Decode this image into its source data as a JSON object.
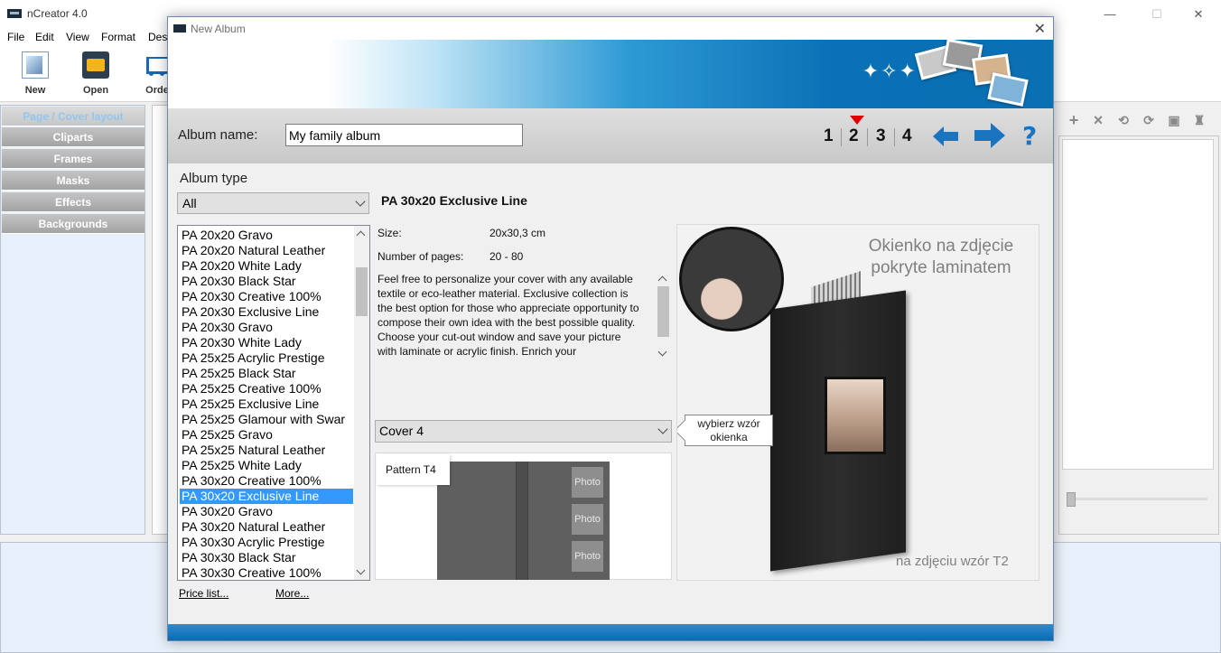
{
  "app": {
    "title": "nCreator 4.0",
    "menu": [
      "File",
      "Edit",
      "View",
      "Format",
      "Desi"
    ],
    "toolbar": [
      "New",
      "Open",
      "Orde"
    ],
    "left_panel": [
      "Page / Cover layout",
      "Cliparts",
      "Frames",
      "Masks",
      "Effects",
      "Backgrounds"
    ],
    "window_controls": {
      "minimize": "—",
      "maximize": "☐",
      "close": "✕"
    }
  },
  "dialog": {
    "title": "New Album",
    "close": "✕",
    "album_name_label": "Album name:",
    "album_name_value": "My family album",
    "steps": [
      "1",
      "2",
      "3",
      "4"
    ],
    "current_step": "2",
    "help": "?",
    "album_type_label": "Album type",
    "album_type_value": "All",
    "album_list": [
      "PA 20x20  Gravo",
      "PA 20x20  Natural Leather",
      "PA 20x20  White Lady",
      "PA 20x30  Black Star",
      "PA 20x30  Creative 100%",
      "PA 20x30  Exclusive Line",
      "PA 20x30  Gravo",
      "PA 20x30  White Lady",
      "PA 25x25  Acrylic Prestige",
      "PA 25x25  Black Star",
      "PA 25x25  Creative 100%",
      "PA 25x25  Exclusive Line",
      "PA 25x25  Glamour with Swar",
      "PA 25x25  Gravo",
      "PA 25x25  Natural Leather",
      "PA 25x25  White Lady",
      "PA 30x20  Creative 100%",
      "PA 30x20  Exclusive Line",
      "PA 30x20  Gravo",
      "PA 30x20  Natural Leather",
      "PA 30x30  Acrylic Prestige",
      "PA 30x30  Black Star",
      "PA 30x30  Creative 100%"
    ],
    "selected_album": "PA 30x20  Exclusive Line",
    "links": {
      "price_list": "Price list...",
      "more": "More..."
    },
    "product": {
      "title": "PA 30x20  Exclusive Line",
      "size_label": "Size:",
      "size_value": "20x30,3 cm",
      "pages_label": "Number of pages:",
      "pages_value": "20 - 80",
      "description": "Feel free to personalize your cover with any available textile or eco-leather material. Exclusive collection is the best option for those who appreciate opportunity to compose their own idea with the best possible quality. Choose your cut-out window and save your picture with laminate or acrylic finish. Enrich your"
    },
    "cover_select": "Cover 4",
    "pattern_label": "Pattern T4",
    "photo_slots": [
      "Photo",
      "Photo",
      "Photo"
    ],
    "preview": {
      "caption_top": "Okienko na zdjęcie pokryte laminatem",
      "caption_bottom": "na zdjęciu wzór T2",
      "window_label": "wybierz wzór okienka"
    }
  }
}
